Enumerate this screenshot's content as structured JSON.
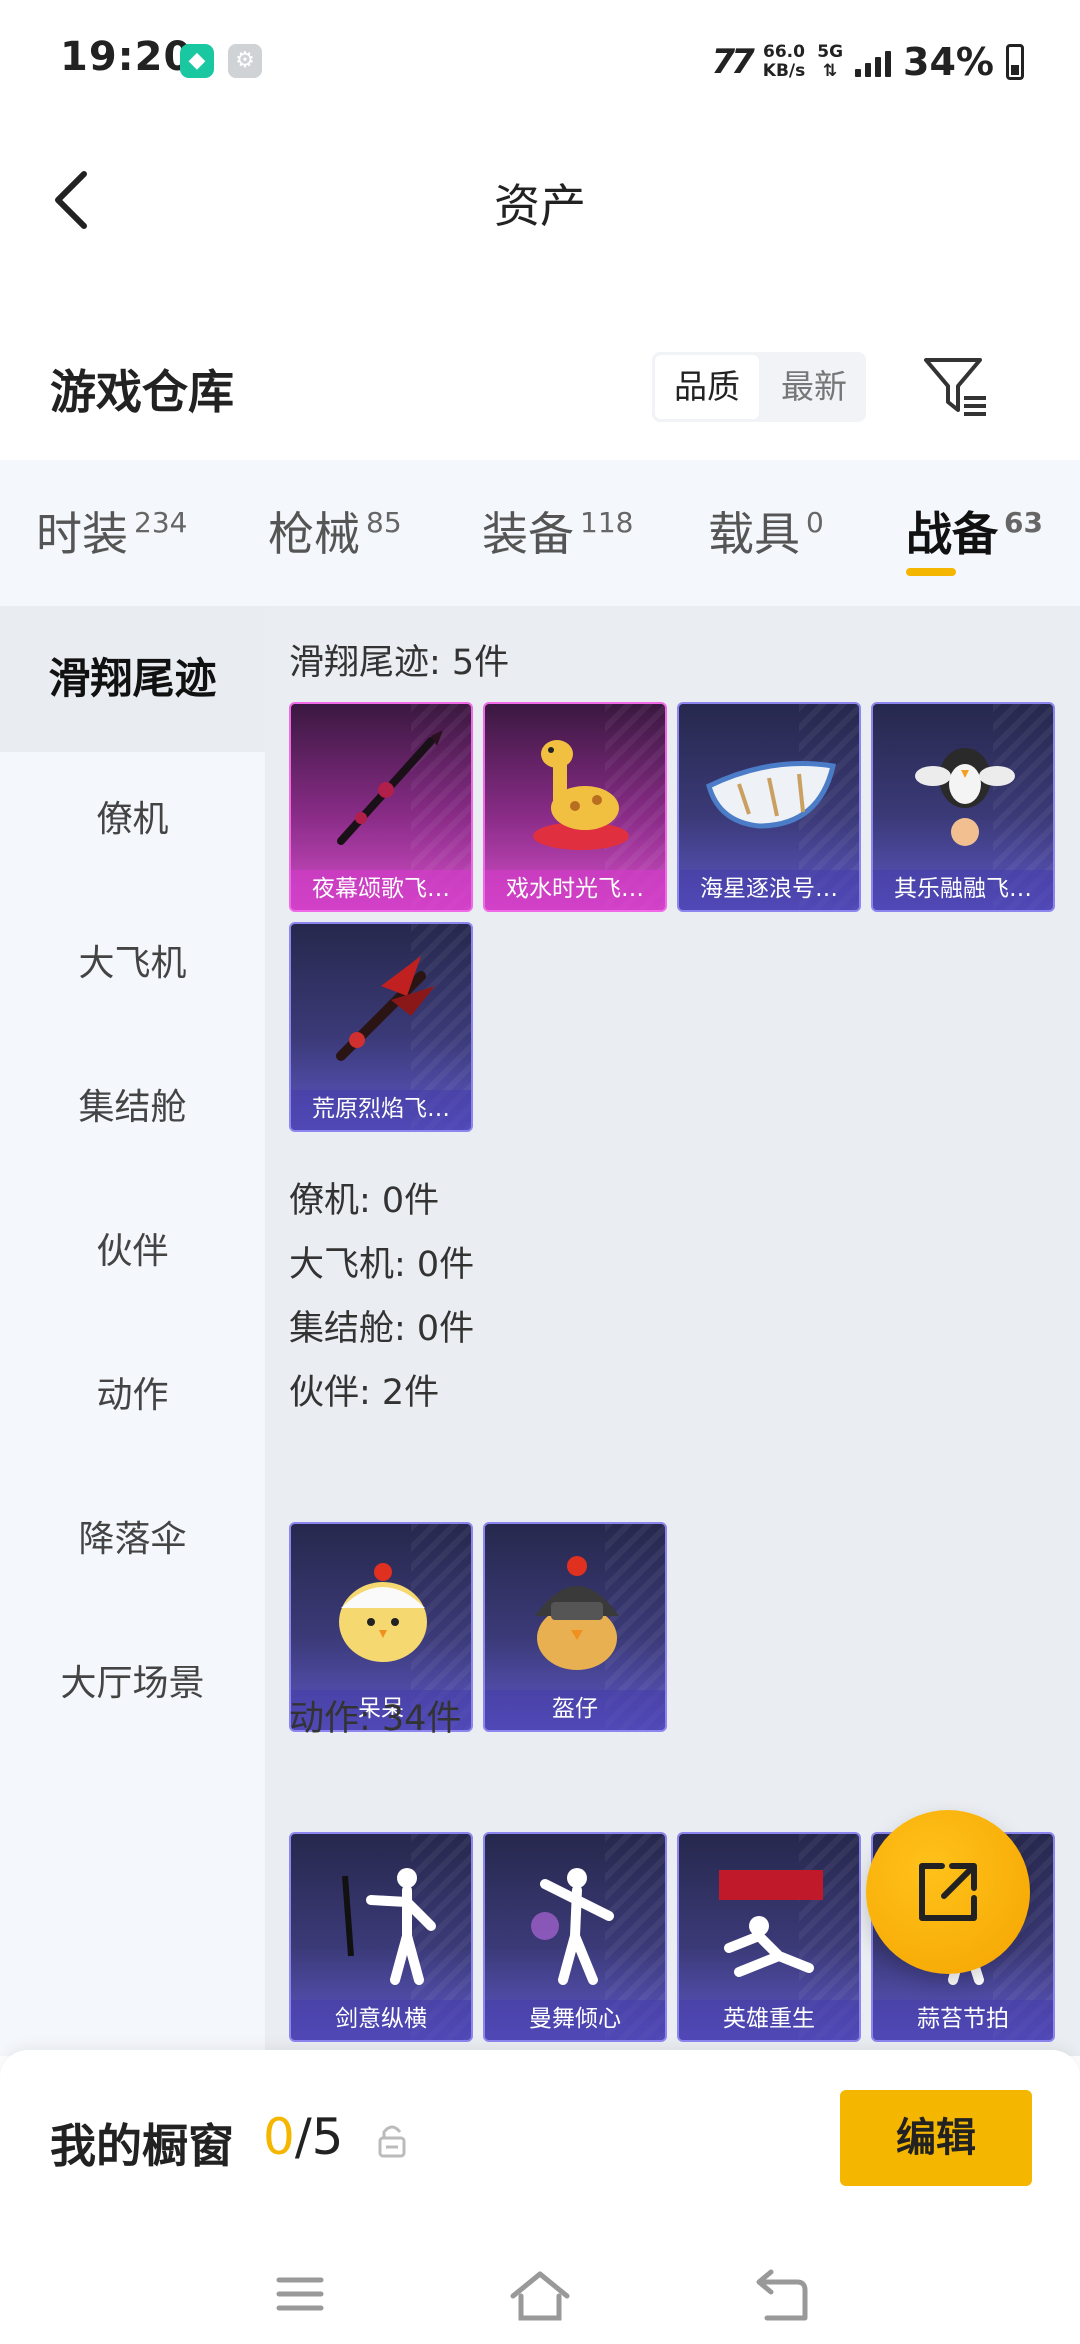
{
  "status_bar": {
    "time": "19:20",
    "speed_value": "66.0",
    "speed_unit": "KB/s",
    "network": "5G",
    "battery": "34%",
    "icons": [
      "app-shield-icon",
      "settings-app-icon",
      "signal-icon",
      "battery-icon"
    ]
  },
  "header": {
    "title": "资产",
    "back_icon": "chevron-left-icon"
  },
  "warehouse": {
    "title": "游戏仓库",
    "sort_options": [
      "品质",
      "最新"
    ],
    "active_sort": "品质",
    "filter_icon": "filter-icon"
  },
  "tabs": [
    {
      "label": "时装",
      "count": "234"
    },
    {
      "label": "枪械",
      "count": "85"
    },
    {
      "label": "装备",
      "count": "118"
    },
    {
      "label": "载具",
      "count": "0"
    },
    {
      "label": "战备",
      "count": "63"
    }
  ],
  "active_tab": "战备",
  "side_nav": [
    "滑翔尾迹",
    "僚机",
    "大飞机",
    "集结舱",
    "伙伴",
    "动作",
    "降落伞",
    "大厅场景"
  ],
  "active_side": "滑翔尾迹",
  "sections": {
    "glide_trail": {
      "title": "滑翔尾迹: 5件",
      "items": [
        {
          "name": "夜幕颂歌飞…",
          "rarity": "pink"
        },
        {
          "name": "戏水时光飞…",
          "rarity": "pink"
        },
        {
          "name": "海星逐浪号…",
          "rarity": "blue"
        },
        {
          "name": "其乐融融飞…",
          "rarity": "blue"
        },
        {
          "name": "荒原烈焰飞…",
          "rarity": "blue"
        }
      ]
    },
    "wingman": {
      "title": "僚机: 0件"
    },
    "big_plane": {
      "title": "大飞机: 0件"
    },
    "rally_pod": {
      "title": "集结舱: 0件"
    },
    "companion": {
      "title": "伙伴: 2件",
      "items": [
        {
          "name": "呆呆",
          "rarity": "blue"
        },
        {
          "name": "盔仔",
          "rarity": "blue"
        }
      ]
    },
    "emote": {
      "title": "动作: 34件",
      "items": [
        {
          "name": "剑意纵横",
          "rarity": "blue"
        },
        {
          "name": "曼舞倾心",
          "rarity": "blue"
        },
        {
          "name": "英雄重生",
          "rarity": "blue"
        },
        {
          "name": "蒜苔节拍",
          "rarity": "blue"
        }
      ]
    }
  },
  "fab": {
    "icon": "share-external-icon"
  },
  "showcase": {
    "title": "我的橱窗",
    "current": "0",
    "separator": "/",
    "max": "5",
    "lock_icon": "lock-icon",
    "edit_label": "编辑"
  },
  "nav_bar": {
    "icons": [
      "menu-icon",
      "home-icon",
      "back-icon"
    ]
  },
  "colors": {
    "accent": "#f5b600",
    "rare_blue": "#5e58c7",
    "rare_pink": "#d44fc9"
  }
}
